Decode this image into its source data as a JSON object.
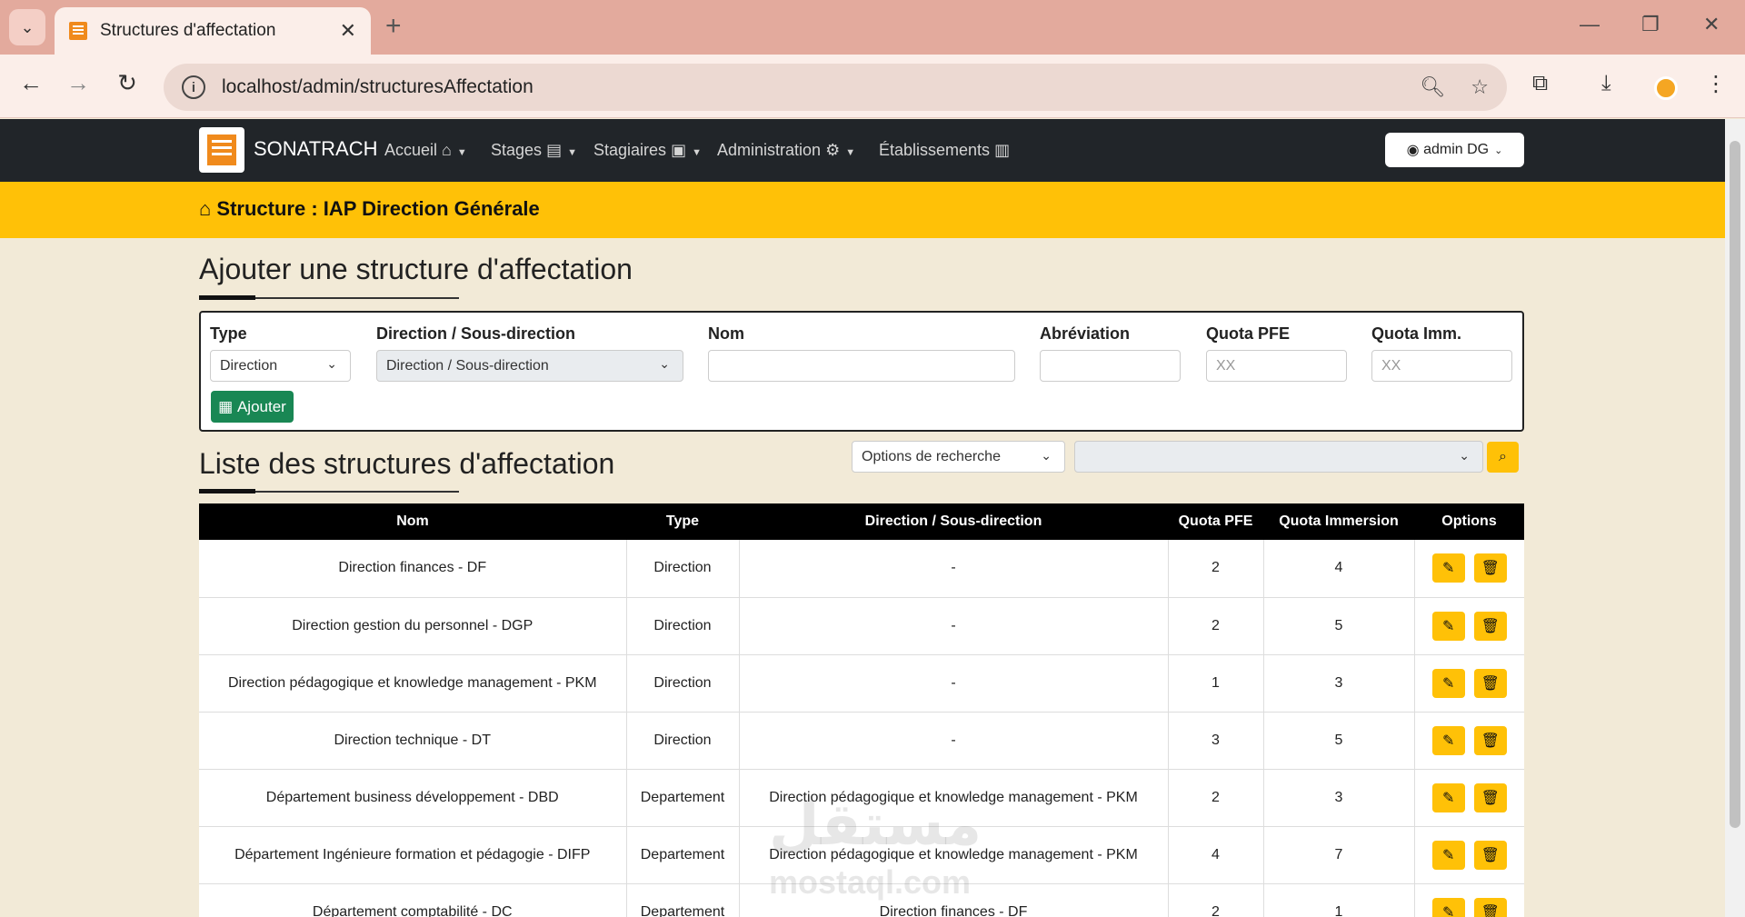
{
  "browser": {
    "tab_title": "Structures d'affectation",
    "url": "localhost/admin/structuresAffectation"
  },
  "app": {
    "brand": "SONATRACH",
    "menu": [
      "Accueil",
      "Stages",
      "Stagiaires",
      "Administration",
      "Établissements"
    ],
    "user": "admin DG"
  },
  "banner": {
    "title": "Structure : IAP Direction Générale"
  },
  "form": {
    "heading": "Ajouter une structure d'affectation",
    "labels": {
      "type": "Type",
      "direction": "Direction / Sous-direction",
      "nom": "Nom",
      "abreviation": "Abréviation",
      "quota_pfe": "Quota PFE",
      "quota_imm": "Quota Imm."
    },
    "type_value": "Direction",
    "direction_value": "Direction / Sous-direction",
    "quota_pfe_placeholder": "XX",
    "quota_imm_placeholder": "XX",
    "add_button": "Ajouter"
  },
  "list": {
    "heading": "Liste des structures d'affectation",
    "search_options": "Options de recherche"
  },
  "table": {
    "headers": [
      "Nom",
      "Type",
      "Direction / Sous-direction",
      "Quota PFE",
      "Quota Immersion",
      "Options"
    ],
    "rows": [
      {
        "nom": "Direction finances - DF",
        "type": "Direction",
        "direction": "-",
        "pfe": "2",
        "imm": "4"
      },
      {
        "nom": "Direction gestion du personnel - DGP",
        "type": "Direction",
        "direction": "-",
        "pfe": "2",
        "imm": "5"
      },
      {
        "nom": "Direction pédagogique et knowledge management - PKM",
        "type": "Direction",
        "direction": "-",
        "pfe": "1",
        "imm": "3"
      },
      {
        "nom": "Direction technique - DT",
        "type": "Direction",
        "direction": "-",
        "pfe": "3",
        "imm": "5"
      },
      {
        "nom": "Département business développement - DBD",
        "type": "Departement",
        "direction": "Direction pédagogique et knowledge management - PKM",
        "pfe": "2",
        "imm": "3"
      },
      {
        "nom": "Département Ingénieure formation et pédagogie - DIFP",
        "type": "Departement",
        "direction": "Direction pédagogique et knowledge management - PKM",
        "pfe": "4",
        "imm": "7"
      },
      {
        "nom": "Département comptabilité - DC",
        "type": "Departement",
        "direction": "Direction finances - DF",
        "pfe": "2",
        "imm": "1"
      }
    ]
  },
  "watermark": {
    "arabic": "مستقل",
    "latin": "mostaql.com"
  },
  "colors": {
    "navbar": "#212529",
    "banner": "#ffc107",
    "add_button": "#198754",
    "action_button": "#ffc107",
    "page_bg": "#f2ead7"
  }
}
